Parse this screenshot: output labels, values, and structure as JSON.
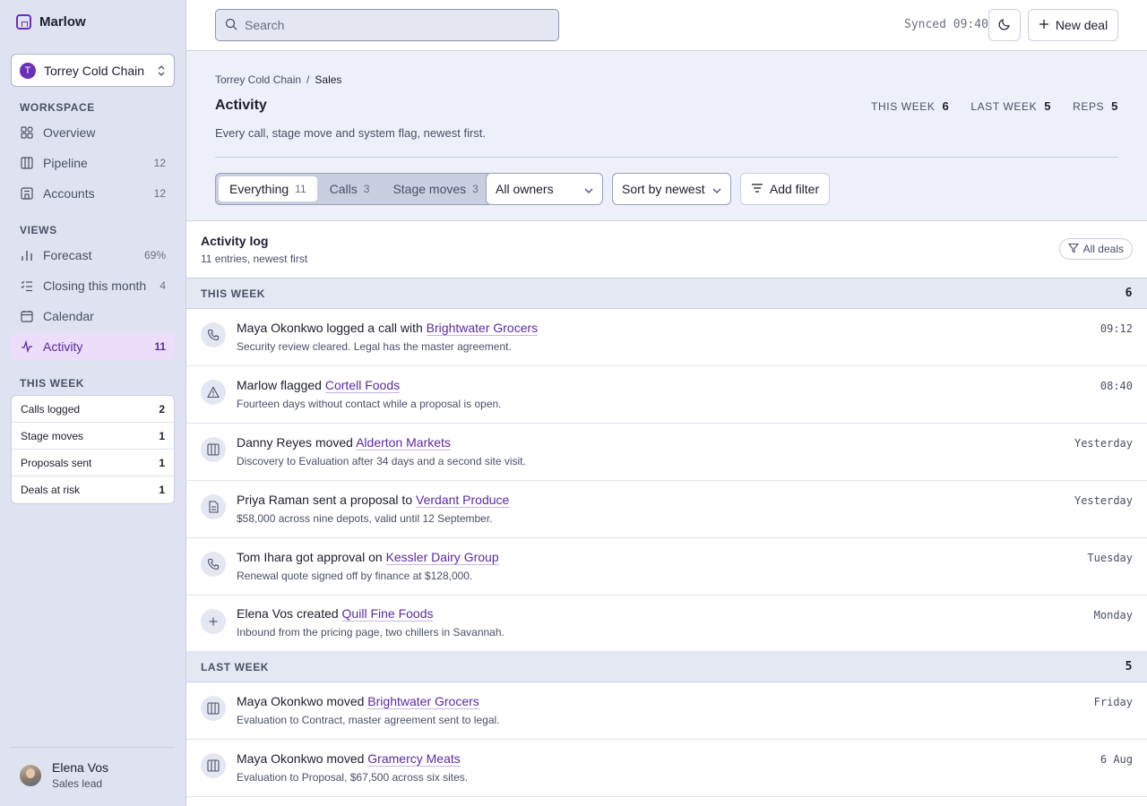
{
  "app": {
    "brand": "Marlow",
    "workspace": {
      "initial": "T",
      "name": "Torrey Cold Chain"
    }
  },
  "sidebar": {
    "workspace_heading": "WORKSPACE",
    "workspace_items": [
      {
        "label": "Overview",
        "count": "",
        "icon": "grid-icon"
      },
      {
        "label": "Pipeline",
        "count": "12",
        "icon": "columns-icon"
      },
      {
        "label": "Accounts",
        "count": "12",
        "icon": "building-icon"
      }
    ],
    "views_heading": "VIEWS",
    "view_items": [
      {
        "label": "Forecast",
        "count": "69%",
        "icon": "bar-chart-icon"
      },
      {
        "label": "Closing this month",
        "count": "4",
        "icon": "checklist-icon"
      },
      {
        "label": "Calendar",
        "count": "",
        "icon": "calendar-icon"
      },
      {
        "label": "Activity",
        "count": "11",
        "icon": "pulse-icon",
        "active": true
      }
    ],
    "this_week_heading": "THIS WEEK",
    "this_week": [
      {
        "label": "Calls logged",
        "value": "2"
      },
      {
        "label": "Stage moves",
        "value": "1"
      },
      {
        "label": "Proposals sent",
        "value": "1"
      },
      {
        "label": "Deals at risk",
        "value": "1"
      }
    ],
    "user": {
      "name": "Elena Vos",
      "role": "Sales lead"
    }
  },
  "topbar": {
    "search_placeholder": "Search",
    "synced": "Synced 09:40",
    "new_deal": "New deal"
  },
  "header": {
    "breadcrumb": [
      "Torrey Cold Chain",
      "/",
      "Sales"
    ],
    "title": "Activity",
    "description": "Every call, stage move and system flag, newest first.",
    "stats": [
      {
        "label": "THIS WEEK",
        "value": "6"
      },
      {
        "label": "LAST WEEK",
        "value": "5"
      },
      {
        "label": "REPS",
        "value": "5"
      }
    ],
    "segments": [
      {
        "label": "Everything",
        "count": "11",
        "active": true
      },
      {
        "label": "Calls",
        "count": "3"
      },
      {
        "label": "Stage moves",
        "count": "3"
      }
    ],
    "owner_filter": "All owners",
    "sort": "Sort by newest",
    "add_filter": "Add filter"
  },
  "log": {
    "title": "Activity log",
    "subtitle": "11 entries, newest first",
    "scope": "All deals",
    "groups": [
      {
        "label": "THIS WEEK",
        "count": "6",
        "entries": [
          {
            "icon": "phone-icon",
            "actor": "Maya Okonkwo",
            "verb": "logged a call with",
            "deal": "Brightwater Grocers",
            "detail": "Security review cleared. Legal has the master agreement.",
            "time": "09:12"
          },
          {
            "icon": "warning-icon",
            "actor": "Marlow",
            "verb": "flagged",
            "deal": "Cortell Foods",
            "detail": "Fourteen days without contact while a proposal is open.",
            "time": "08:40"
          },
          {
            "icon": "columns-icon",
            "actor": "Danny Reyes",
            "verb": "moved",
            "deal": "Alderton Markets",
            "detail": "Discovery to Evaluation after 34 days and a second site visit.",
            "time": "Yesterday"
          },
          {
            "icon": "document-icon",
            "actor": "Priya Raman",
            "verb": "sent a proposal to",
            "deal": "Verdant Produce",
            "detail": "$58,000 across nine depots, valid until 12 September.",
            "time": "Yesterday"
          },
          {
            "icon": "phone-icon",
            "actor": "Tom Ihara",
            "verb": "got approval on",
            "deal": "Kessler Dairy Group",
            "detail": "Renewal quote signed off by finance at $128,000.",
            "time": "Tuesday"
          },
          {
            "icon": "plus-icon",
            "actor": "Elena Vos",
            "verb": "created",
            "deal": "Quill Fine Foods",
            "detail": "Inbound from the pricing page, two chillers in Savannah.",
            "time": "Monday"
          }
        ]
      },
      {
        "label": "LAST WEEK",
        "count": "5",
        "entries": [
          {
            "icon": "columns-icon",
            "actor": "Maya Okonkwo",
            "verb": "moved",
            "deal": "Brightwater Grocers",
            "detail": "Evaluation to Contract, master agreement sent to legal.",
            "time": "Friday"
          },
          {
            "icon": "columns-icon",
            "actor": "Maya Okonkwo",
            "verb": "moved",
            "deal": "Gramercy Meats",
            "detail": "Evaluation to Proposal, $67,500 across six sites.",
            "time": "6 Aug"
          }
        ]
      }
    ]
  },
  "colors": {
    "accent": "#6b2fb8",
    "sidebar_bg": "#dfe3f1",
    "header_bg": "#edf0f8",
    "active_nav_bg": "#ecddfa"
  }
}
